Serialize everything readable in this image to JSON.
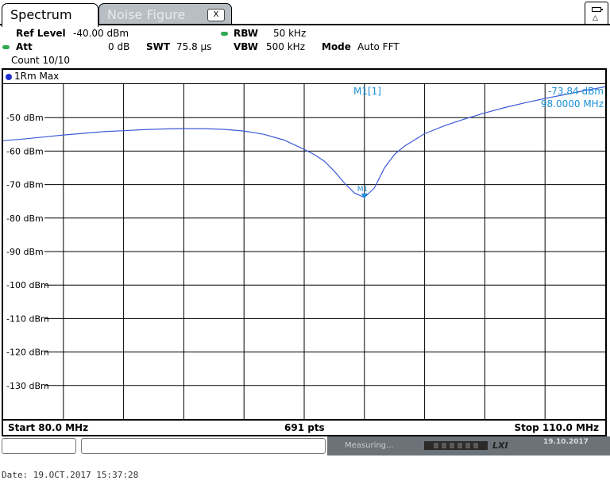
{
  "tabs": [
    {
      "label": "Spectrum",
      "active": true
    },
    {
      "label": "Noise Figure",
      "active": false,
      "close_label": "X"
    }
  ],
  "settings": {
    "ref_level_label": "Ref Level",
    "ref_level_value": "-40.00 dBm",
    "att_label": "Att",
    "att_value": "0 dB",
    "swt_label": "SWT",
    "swt_value": "75.8 µs",
    "rbw_label": "RBW",
    "rbw_value": "50 kHz",
    "vbw_label": "VBW",
    "vbw_value": "500 kHz",
    "mode_label": "Mode",
    "mode_value": "Auto FFT",
    "count": "Count 10/10"
  },
  "trace_label": "1Rm Max",
  "marker": {
    "name": "M1[1]",
    "level": "-73.84 dBm",
    "freq": "98.0000 MHz",
    "tag": "M1"
  },
  "footer": {
    "start": "Start 80.0 MHz",
    "points": "691 pts",
    "stop": "Stop 110.0 MHz"
  },
  "status": {
    "text": "Measuring...",
    "lxi": "LXI",
    "date": "19.10.2017"
  },
  "print_date": "Date: 19.OCT.2017  15:37:28",
  "colors": {
    "trace": "#3d5bd9",
    "marker": "#1a8fd6",
    "grid": "#000000"
  },
  "chart_data": {
    "type": "line",
    "x_unit": "MHz",
    "y_unit": "dBm",
    "xlim": [
      80,
      110
    ],
    "ylim": [
      -140,
      -40
    ],
    "y_ticks": [
      {
        "value": -50,
        "label": "-50 dBm"
      },
      {
        "value": -60,
        "label": "-60 dBm"
      },
      {
        "value": -70,
        "label": "-70 dBm"
      },
      {
        "value": -80,
        "label": "-80 dBm"
      },
      {
        "value": -90,
        "label": "-90 dBm"
      },
      {
        "value": -100,
        "label": "-100 dBm"
      },
      {
        "value": -110,
        "label": "-110 dBm"
      },
      {
        "value": -120,
        "label": "-120 dBm"
      },
      {
        "value": -130,
        "label": "-130 dBm"
      }
    ],
    "x_gridlines": 10,
    "grid": true,
    "series": [
      {
        "x": [
          80,
          81,
          82,
          83,
          84,
          85,
          86,
          87,
          88,
          89,
          90,
          91,
          92,
          93,
          94,
          95,
          95.5,
          96,
          96.5,
          97,
          97.5,
          98,
          98.5,
          99,
          99.5,
          100,
          101,
          102,
          103,
          104,
          105,
          106,
          107,
          108,
          109,
          110
        ],
        "y": [
          -56.9,
          -56.4,
          -55.8,
          -55.2,
          -54.7,
          -54.2,
          -53.9,
          -53.6,
          -53.4,
          -53.3,
          -53.3,
          -53.5,
          -54.0,
          -55.0,
          -56.7,
          -59.5,
          -61.0,
          -63.0,
          -66.0,
          -69.5,
          -72.5,
          -73.84,
          -71.0,
          -65.0,
          -61.0,
          -58.5,
          -54.8,
          -52.4,
          -50.4,
          -48.6,
          -47.0,
          -45.6,
          -44.3,
          -43.1,
          -41.9,
          -40.8
        ]
      }
    ],
    "marker_point": {
      "x": 98.0,
      "y": -73.84
    }
  }
}
